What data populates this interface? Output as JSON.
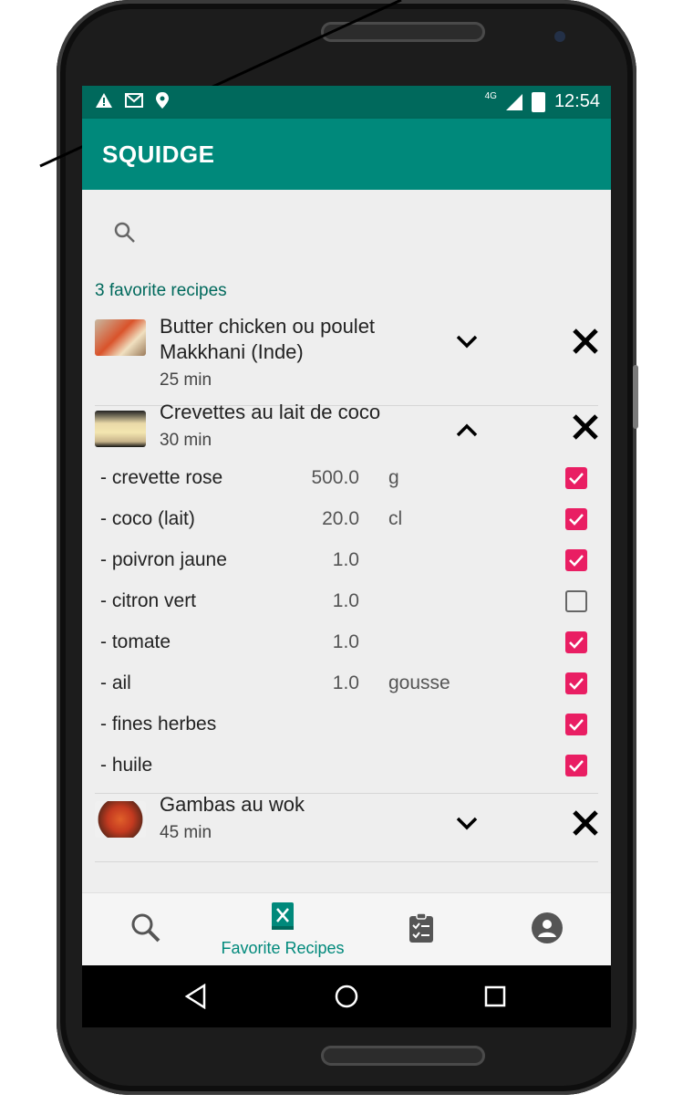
{
  "status_bar": {
    "network": "4G",
    "time": "12:54"
  },
  "app_bar": {
    "title": "SQUIDGE"
  },
  "favorites": {
    "count_label": "3 favorite recipes",
    "recipes": [
      {
        "title": "Butter chicken ou poulet Makkhani (Inde)",
        "time": "25 min",
        "expanded": false
      },
      {
        "title": "Crevettes au lait de coco",
        "time": "30 min",
        "expanded": true,
        "ingredients": [
          {
            "name": "- crevette rose",
            "qty": "500.0",
            "unit": "g",
            "checked": true
          },
          {
            "name": "- coco (lait)",
            "qty": "20.0",
            "unit": "cl",
            "checked": true
          },
          {
            "name": "- poivron jaune",
            "qty": "1.0",
            "unit": "",
            "checked": true
          },
          {
            "name": "- citron vert",
            "qty": "1.0",
            "unit": "",
            "checked": false
          },
          {
            "name": "- tomate",
            "qty": "1.0",
            "unit": "",
            "checked": true
          },
          {
            "name": "- ail",
            "qty": "1.0",
            "unit": "gousse",
            "checked": true
          },
          {
            "name": "- fines herbes",
            "qty": "",
            "unit": "",
            "checked": true
          },
          {
            "name": "- huile",
            "qty": "",
            "unit": "",
            "checked": true
          }
        ]
      },
      {
        "title": "Gambas au wok",
        "time": "45 min",
        "expanded": false
      }
    ]
  },
  "bottom_nav": {
    "items": [
      {
        "icon": "search-icon",
        "label": ""
      },
      {
        "icon": "favorite-recipes-icon",
        "label": "Favorite Recipes",
        "active": true
      },
      {
        "icon": "clipboard-checklist-icon",
        "label": ""
      },
      {
        "icon": "account-icon",
        "label": ""
      }
    ]
  },
  "colors": {
    "primary": "#00897b",
    "primary_dark": "#00695c",
    "checkbox_checked": "#e91e63",
    "background": "#eeeeee"
  }
}
